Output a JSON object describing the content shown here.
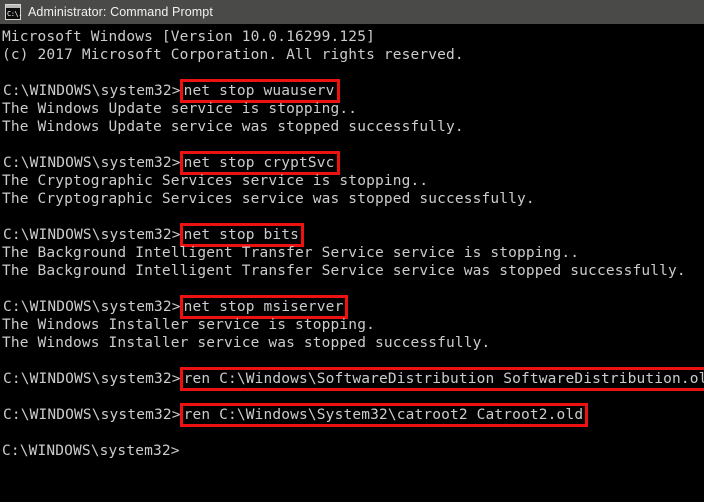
{
  "window": {
    "title": "Administrator: Command Prompt",
    "icon": "command-prompt-icon",
    "icon_glyph": "C:\\.",
    "colors": {
      "titlebar_background": "#4a4a48",
      "titlebar_text": "#f2f2f2",
      "console_background": "#000000",
      "console_text": "#cccccc",
      "highlight_box": "#ee1111"
    }
  },
  "console": {
    "banner": [
      "Microsoft Windows [Version 10.0.16299.125]",
      "(c) 2017 Microsoft Corporation. All rights reserved."
    ],
    "prompt": "C:\\WINDOWS\\system32>",
    "blocks": [
      {
        "command": "net stop wuauserv",
        "highlighted": true,
        "output": [
          "The Windows Update service is stopping..",
          "The Windows Update service was stopped successfully."
        ]
      },
      {
        "command": "net stop cryptSvc",
        "highlighted": true,
        "output": [
          "The Cryptographic Services service is stopping..",
          "The Cryptographic Services service was stopped successfully."
        ]
      },
      {
        "command": "net stop bits",
        "highlighted": true,
        "output": [
          "The Background Intelligent Transfer Service service is stopping..",
          "The Background Intelligent Transfer Service service was stopped successfully."
        ]
      },
      {
        "command": "net stop msiserver",
        "highlighted": true,
        "output": [
          "The Windows Installer service is stopping.",
          "The Windows Installer service was stopped successfully."
        ]
      },
      {
        "command": "ren C:\\Windows\\SoftwareDistribution SoftwareDistribution.old",
        "highlighted": true,
        "output": []
      },
      {
        "command": "ren C:\\Windows\\System32\\catroot2 Catroot2.old",
        "highlighted": true,
        "output": []
      }
    ],
    "final_prompt": "C:\\WINDOWS\\system32>"
  }
}
